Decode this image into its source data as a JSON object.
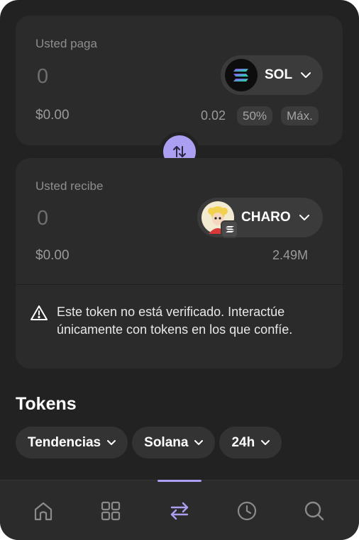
{
  "pay": {
    "label": "Usted paga",
    "amount": "0",
    "usd": "$0.00",
    "token": "SOL",
    "balance": "0.02",
    "chips": [
      "50%",
      "Máx."
    ]
  },
  "receive": {
    "label": "Usted recibe",
    "amount": "0",
    "usd": "$0.00",
    "token": "CHARO",
    "balance": "2.49M",
    "warning": "Este token no está verificado. Interactúe únicamente con tokens en los que confíe."
  },
  "tokens": {
    "title": "Tokens",
    "filters": [
      "Tendencias",
      "Solana",
      "24h"
    ]
  },
  "nav": {
    "items": [
      "home-icon",
      "apps-grid-icon",
      "swap-icon",
      "history-clock-icon",
      "search-icon"
    ],
    "active": "swap-icon",
    "accent": "#ab9ff2"
  }
}
